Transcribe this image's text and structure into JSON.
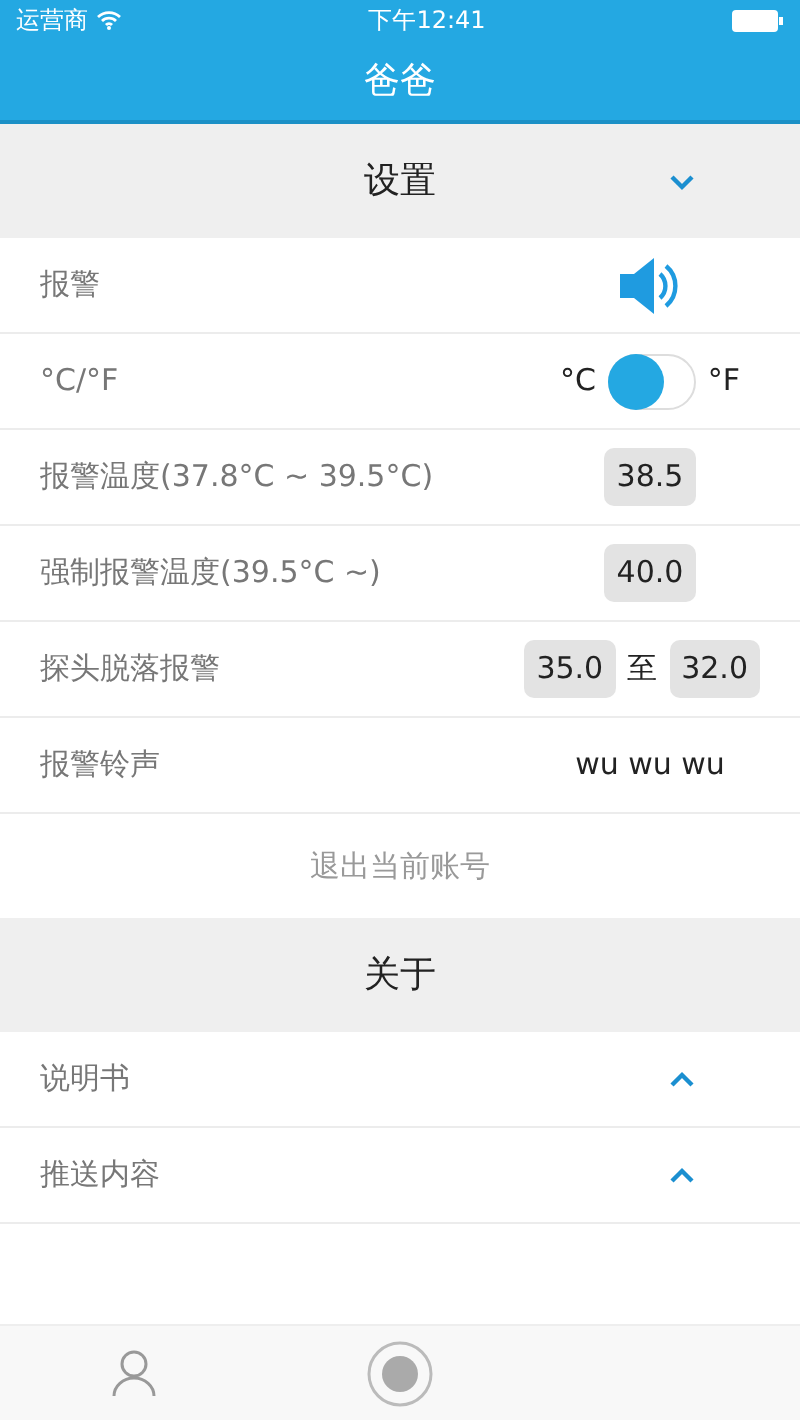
{
  "status_bar": {
    "carrier": "运营商",
    "time": "下午12:41"
  },
  "title": "爸爸",
  "settings": {
    "title": "设置",
    "expanded": true,
    "rows": [
      {
        "kind": "sound",
        "label": "报警",
        "on": true
      },
      {
        "kind": "switch",
        "label": "°C/°F",
        "left": "°C",
        "right": "°F",
        "on": false
      },
      {
        "kind": "value",
        "label": "报警温度(37.8°C ~ 39.5°C)",
        "value": "38.5"
      },
      {
        "kind": "value",
        "label": "强制报警温度(39.5°C ~)",
        "value": "40.0"
      },
      {
        "kind": "range",
        "label": "探头脱落报警",
        "from": "35.0",
        "sep": "至",
        "to": "32.0"
      },
      {
        "kind": "text",
        "label": "报警铃声",
        "value": "wu wu wu"
      }
    ],
    "logout": "退出当前账号"
  },
  "about": {
    "title": "关于",
    "items": [
      {
        "label": "说明书",
        "expanded": false
      },
      {
        "label": "推送内容",
        "expanded": false
      }
    ]
  },
  "tab_bar": [
    {
      "kind": "person"
    },
    {
      "kind": "circle"
    }
  ]
}
